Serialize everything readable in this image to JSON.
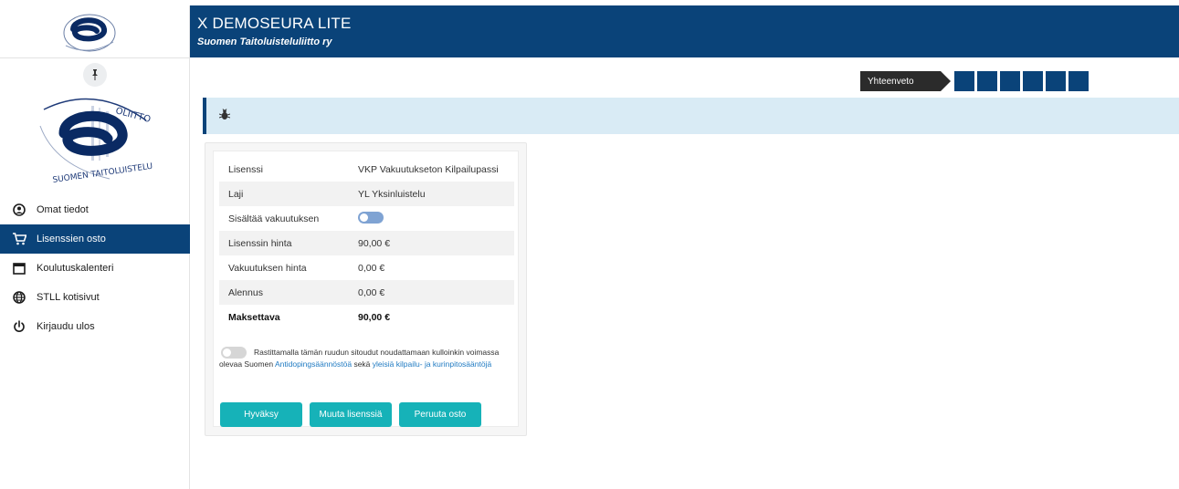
{
  "header": {
    "title": "X DEMOSEURA LITE",
    "subtitle": "Suomen Taitoluisteluliitto ry"
  },
  "sidebar": {
    "pin_icon": "pin-icon",
    "items": [
      {
        "label": "Omat tiedot",
        "icon": "user-icon",
        "active": false
      },
      {
        "label": "Lisenssien osto",
        "icon": "cart-icon",
        "active": true
      },
      {
        "label": "Koulutuskalenteri",
        "icon": "calendar-icon",
        "active": false
      },
      {
        "label": "STLL kotisivut",
        "icon": "globe-icon",
        "active": false
      },
      {
        "label": "Kirjaudu ulos",
        "icon": "power-icon",
        "active": false
      }
    ]
  },
  "steps": {
    "current": "Yhteenveto",
    "remaining_count": 6
  },
  "banner": {
    "icon": "bug-icon"
  },
  "summary": {
    "rows": [
      {
        "label": "Lisenssi",
        "value": "VKP Vakuutukseton Kilpailupassi"
      },
      {
        "label": "Laji",
        "value": "YL Yksinluistelu"
      },
      {
        "label": "Sisältää vakuutuksen",
        "value": ""
      },
      {
        "label": "Lisenssin hinta",
        "value": "90,00 €"
      },
      {
        "label": "Vakuutuksen hinta",
        "value": "0,00 €"
      },
      {
        "label": "Alennus",
        "value": "0,00 €"
      },
      {
        "label": "Maksettava",
        "value": "90,00 €"
      }
    ],
    "consent_text_1": "Rastittamalla tämän ruudun sitoudut noudattamaan kulloinkin voimassa olevaa Suomen ",
    "consent_link_1": "Antidopingsäännöstöä",
    "consent_text_2": " sekä ",
    "consent_link_2": "yleisiä kilpailu- ja kurinpitosääntöjä",
    "buttons": {
      "accept": "Hyväksy",
      "change": "Muuta lisenssiä",
      "cancel": "Peruuta osto"
    }
  },
  "colors": {
    "brand": "#0a4379",
    "button": "#16b2b8",
    "banner": "#d9ebf5",
    "link": "#1f7ac2"
  }
}
